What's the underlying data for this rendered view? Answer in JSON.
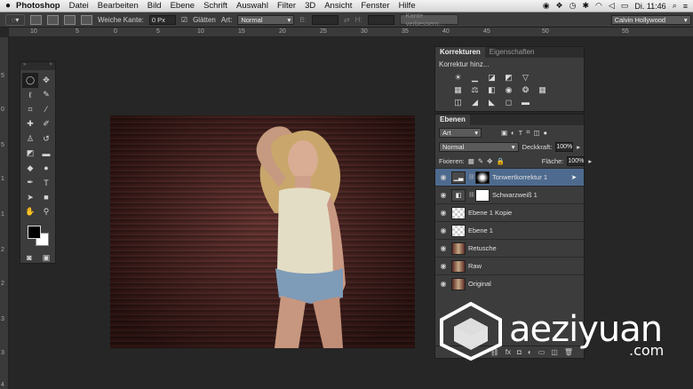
{
  "menubar": {
    "app_name": "Photoshop",
    "items": [
      "Datei",
      "Bearbeiten",
      "Bild",
      "Ebene",
      "Schrift",
      "Auswahl",
      "Filter",
      "3D",
      "Ansicht",
      "Fenster",
      "Hilfe"
    ],
    "clock": "Di. 11:46"
  },
  "options": {
    "feather_label": "Weiche Kante:",
    "feather_value": "0 Px",
    "antialias_label": "Glätten",
    "style_label": "Art:",
    "style_value": "Normal",
    "width_label": "B:",
    "height_label": "H:",
    "refine_button": "Kante verbessern...",
    "workspace": "Calvin Hollywood"
  },
  "rulers": {
    "top": [
      "10",
      "5",
      "0",
      "5",
      "10",
      "15",
      "20",
      "25",
      "30",
      "35",
      "40",
      "45",
      "50",
      "55"
    ],
    "left": [
      "5",
      "0",
      "5",
      "1",
      "1",
      "2",
      "2",
      "3",
      "3",
      "4"
    ]
  },
  "adjustments": {
    "tabs": [
      "Korrekturen",
      "Eigenschaften"
    ],
    "title": "Korrektur hinz..."
  },
  "layers_panel": {
    "tab": "Ebenen",
    "filter_kind": "Art",
    "blend_mode": "Normal",
    "opacity_label": "Deckkraft:",
    "opacity_value": "100%",
    "lock_label": "Fixieren:",
    "fill_label": "Fläche:",
    "fill_value": "100%",
    "layers": [
      {
        "name": "Tonwertkorrektur 1",
        "selected": true
      },
      {
        "name": "Schwarzweiß 1",
        "selected": false
      },
      {
        "name": "Ebene 1 Kopie",
        "selected": false
      },
      {
        "name": "Ebene 1",
        "selected": false
      },
      {
        "name": "Retusche",
        "selected": false
      },
      {
        "name": "Raw",
        "selected": false
      },
      {
        "name": "Original",
        "selected": false
      }
    ]
  },
  "watermark": {
    "text": "aeziyuan",
    "suffix": ".com"
  },
  "colors": {
    "selected_layer": "#4e6b8f",
    "panel_bg": "#3c3c3c"
  }
}
